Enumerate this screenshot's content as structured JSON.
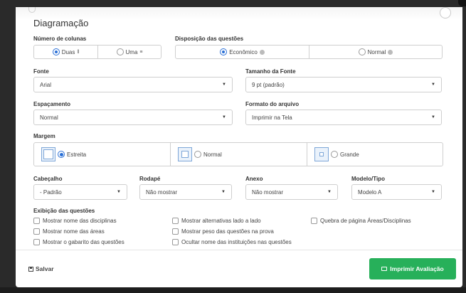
{
  "section_title": "Diagramação",
  "colunas": {
    "label": "Número de colunas",
    "options": [
      {
        "label": "Duas",
        "icon": "two-columns-icon",
        "selected": true
      },
      {
        "label": "Uma",
        "icon": "one-column-icon",
        "selected": false
      }
    ]
  },
  "disposicao": {
    "label": "Disposição das questões",
    "options": [
      {
        "label": "Econômico",
        "selected": true
      },
      {
        "label": "Normal",
        "selected": false
      }
    ]
  },
  "fonte": {
    "label": "Fonte",
    "value": "Arial"
  },
  "tamanho": {
    "label": "Tamanho da Fonte",
    "value": "9 pt (padrão)"
  },
  "espacamento": {
    "label": "Espaçamento",
    "value": "Normal"
  },
  "formato": {
    "label": "Formato do arquivo",
    "value": "Imprimir na Tela"
  },
  "margem": {
    "label": "Margem",
    "options": [
      {
        "label": "Estreita",
        "selected": true
      },
      {
        "label": "Normal",
        "selected": false
      },
      {
        "label": "Grande",
        "selected": false
      }
    ]
  },
  "cabecalho": {
    "label": "Cabeçalho",
    "value": "- Padrão"
  },
  "rodape": {
    "label": "Rodapé",
    "value": "Não mostrar"
  },
  "anexo": {
    "label": "Anexo",
    "value": "Não mostrar"
  },
  "modelo": {
    "label": "Modelo/Tipo",
    "value": "Modelo A"
  },
  "exibicao": {
    "label": "Exibição das questões",
    "checks": [
      "Mostrar nome das disciplinas",
      "Mostrar nome das áreas",
      "Mostrar o gabarito das questões",
      "Mostrar alternativas lado a lado",
      "Mostrar peso das questões na prova",
      "Ocultar nome das instituições nas questões",
      "Quebra de página Áreas/Disciplinas"
    ]
  },
  "footer": {
    "save_label": "Salvar",
    "print_label": "Imprimir Avaliação"
  },
  "colors": {
    "accent": "#2a6fd6",
    "primary_button": "#27b05a"
  }
}
